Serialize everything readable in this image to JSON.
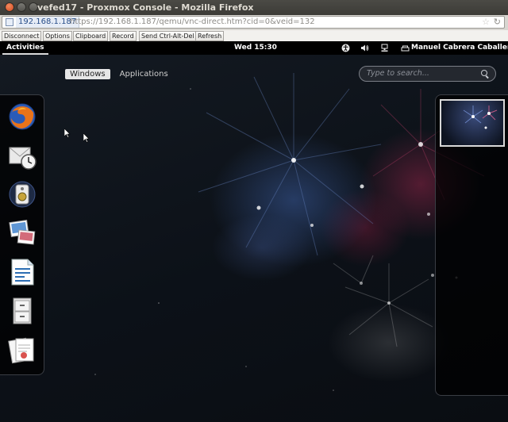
{
  "browser": {
    "window_title": "vefed17 - Proxmox Console - Mozilla Firefox",
    "site_identity": "192.168.1.187",
    "url": "https://192.168.1.187/qemu/vnc-direct.htm?cid=0&veid=132"
  },
  "vnc_toolbar": {
    "buttons": [
      "Disconnect",
      "Options",
      "Clipboard",
      "Record",
      "Send Ctrl-Alt-Del",
      "Refresh"
    ]
  },
  "gnome": {
    "activities_label": "Activities",
    "clock": "Wed 15:30",
    "user_name": "Manuel Cabrera Caballero",
    "view_selector": {
      "windows_label": "Windows",
      "applications_label": "Applications",
      "active": "Windows"
    },
    "search": {
      "placeholder": "Type to search..."
    },
    "dash_icons": [
      "firefox-icon",
      "evolution-mail-clock-icon",
      "rhythmbox-speaker-icon",
      "shotwell-photos-icon",
      "libreoffice-writer-icon",
      "file-cabinet-icon",
      "document-viewer-icon"
    ],
    "status_icons": [
      "accessibility-icon",
      "volume-icon",
      "network-icon",
      "user-status-icon"
    ]
  },
  "colors": {
    "titlebar": "#3c3b37",
    "close_button": "#e05a2b",
    "topbar": "#000000",
    "active_tab": "#e6e6e6"
  }
}
